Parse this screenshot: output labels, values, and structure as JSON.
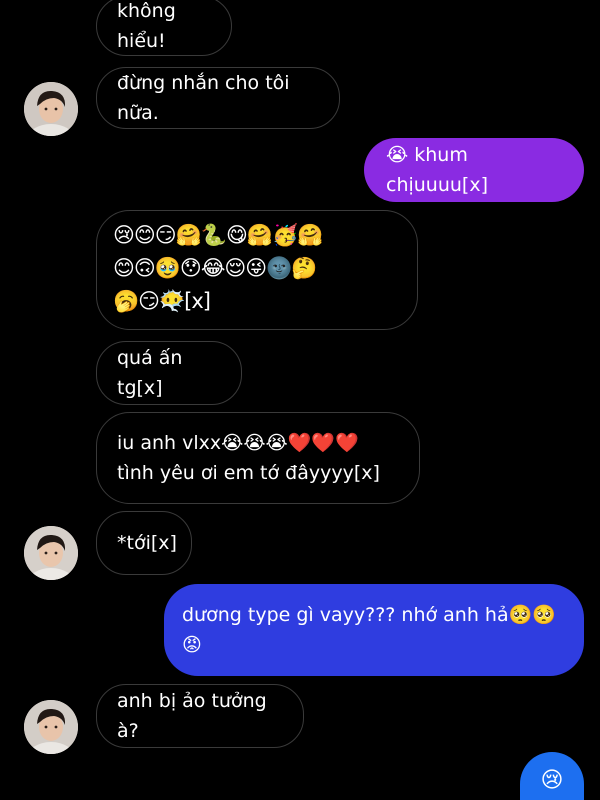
{
  "colors": {
    "background": "#000000",
    "incoming_border": "#3a3a3a",
    "outgoing_purple": "#8a2be2",
    "outgoing_blue": "#2f3de0",
    "outgoing_bottom": "#1d6ff0"
  },
  "messages": [
    {
      "id": "m1",
      "side": "in",
      "text": "không hiểu!"
    },
    {
      "id": "m2",
      "side": "in",
      "text": "đừng nhắn cho tôi nữa.",
      "avatar": "avatar-icon"
    },
    {
      "id": "m3",
      "side": "out",
      "text": "😭 khum chịuuuu[x]"
    },
    {
      "id": "m4",
      "side": "in",
      "text": "😢😊😏🤗🐍😋🤗🥳🤗\n😊🙃🥹😯😂😌😜🌚🤔\n🥱😏😶‍🌫️[x]"
    },
    {
      "id": "m5",
      "side": "in",
      "text": "quá ấn tg[x]"
    },
    {
      "id": "m6",
      "side": "in",
      "text": "iu anh vlxx😭😭😭❤️❤️❤️\ntình yêu ơi em tớ đâyyyy[x]"
    },
    {
      "id": "m7",
      "side": "in",
      "text": "*tới[x]",
      "avatar": "avatar-icon"
    },
    {
      "id": "m8",
      "side": "out",
      "text": "dương type gì vayy??? nhớ anh hả🥺🥺\n😡"
    },
    {
      "id": "m9",
      "side": "in",
      "text": "anh bị ảo tưởng à?",
      "avatar": "avatar-icon"
    },
    {
      "id": "m10",
      "side": "out",
      "text": "😢"
    }
  ]
}
